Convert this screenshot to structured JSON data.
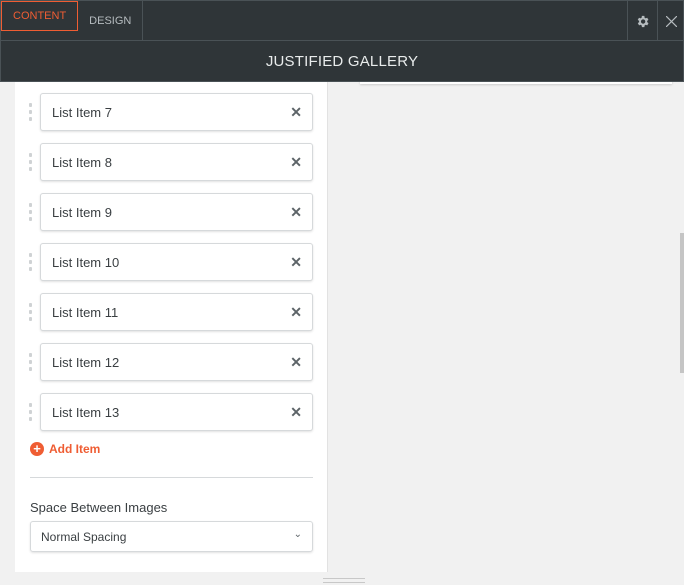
{
  "tabs": [
    {
      "label": "CONTENT",
      "active": true
    },
    {
      "label": "DESIGN",
      "active": false
    }
  ],
  "header": {
    "title": "JUSTIFIED GALLERY"
  },
  "list": {
    "items": [
      "List Item 7",
      "List Item 8",
      "List Item 9",
      "List Item 10",
      "List Item 11",
      "List Item 12",
      "List Item 13"
    ],
    "add_label": "Add Item"
  },
  "spacing": {
    "label": "Space Between Images",
    "value": "Normal Spacing"
  },
  "colors": {
    "accent": "#ef5d33",
    "header_bg": "#2f3538"
  }
}
